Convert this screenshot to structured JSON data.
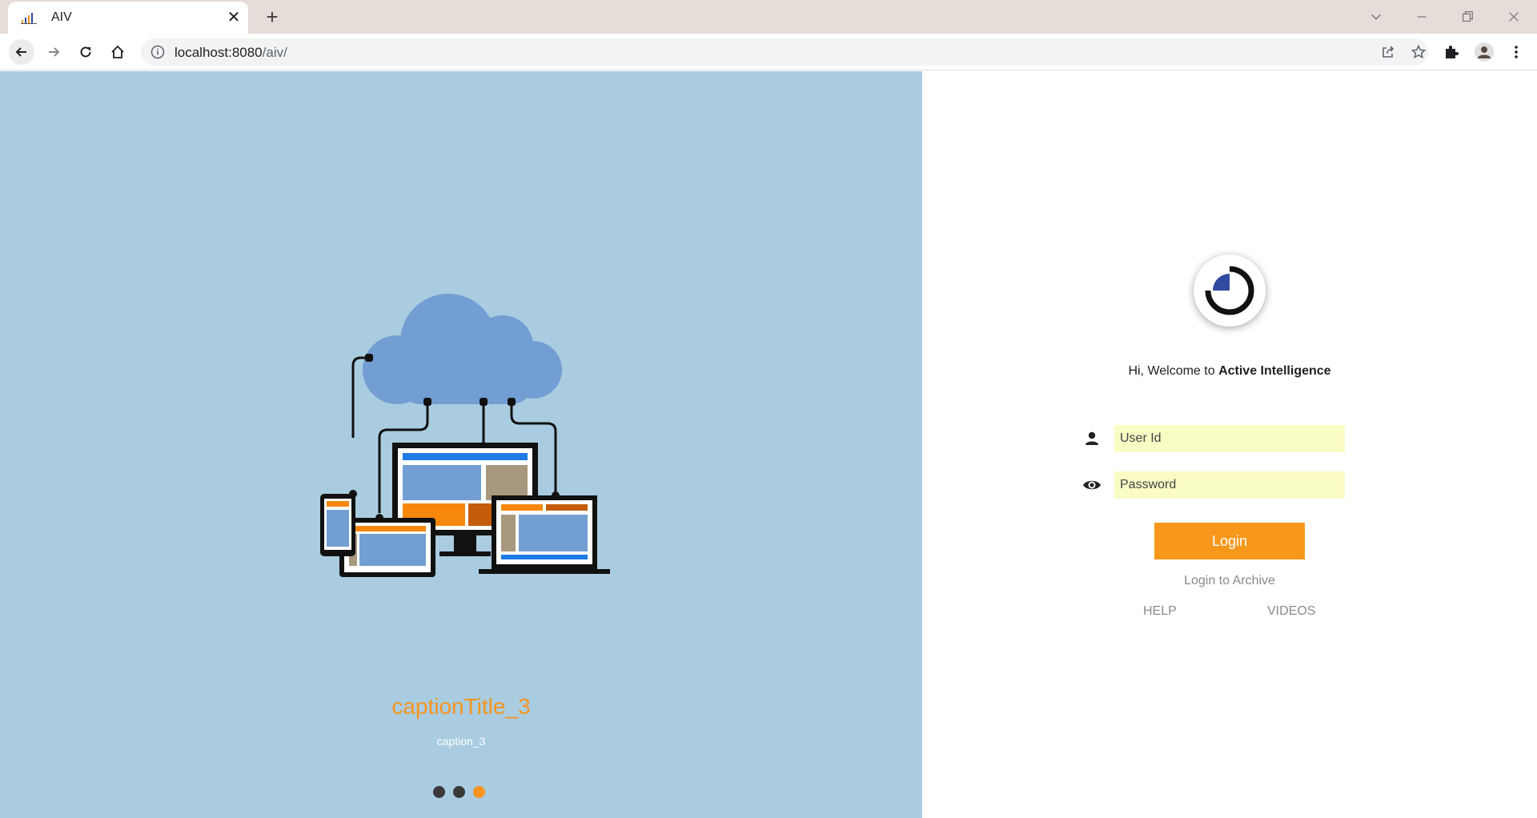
{
  "browser": {
    "tab_title": "AIV",
    "url_host": "localhost:8080",
    "url_path": "/aiv/"
  },
  "icons": {
    "favicon": "aiv-chart-icon",
    "tab_close": "close-icon",
    "new_tab": "plus-icon",
    "back": "arrow-left-icon",
    "forward": "arrow-right-icon",
    "reload": "reload-icon",
    "home": "home-icon",
    "site_info": "info-icon",
    "share": "share-icon",
    "bookmark": "star-icon",
    "extensions": "puzzle-icon",
    "profile": "avatar-icon",
    "menu": "kebab-menu-icon",
    "user_field": "person-icon",
    "password_field": "eye-icon"
  },
  "carousel": {
    "caption_title": "captionTitle_3",
    "caption": "caption_3",
    "slide_count": 3,
    "active_slide": 3
  },
  "login": {
    "welcome_prefix": "Hi, Welcome to ",
    "welcome_brand": "Active Intelligence",
    "user_placeholder": "User Id",
    "password_placeholder": "Password",
    "login_label": "Login",
    "archive_label": "Login to Archive",
    "help_label": "HELP",
    "videos_label": "VIDEOS"
  },
  "colors": {
    "left_panel_bg": "#a9cce0",
    "accent": "#f7941d",
    "input_bg": "#fafcc5",
    "link_gray": "#8a8a8a",
    "logo_blue": "#2f4a9e"
  }
}
